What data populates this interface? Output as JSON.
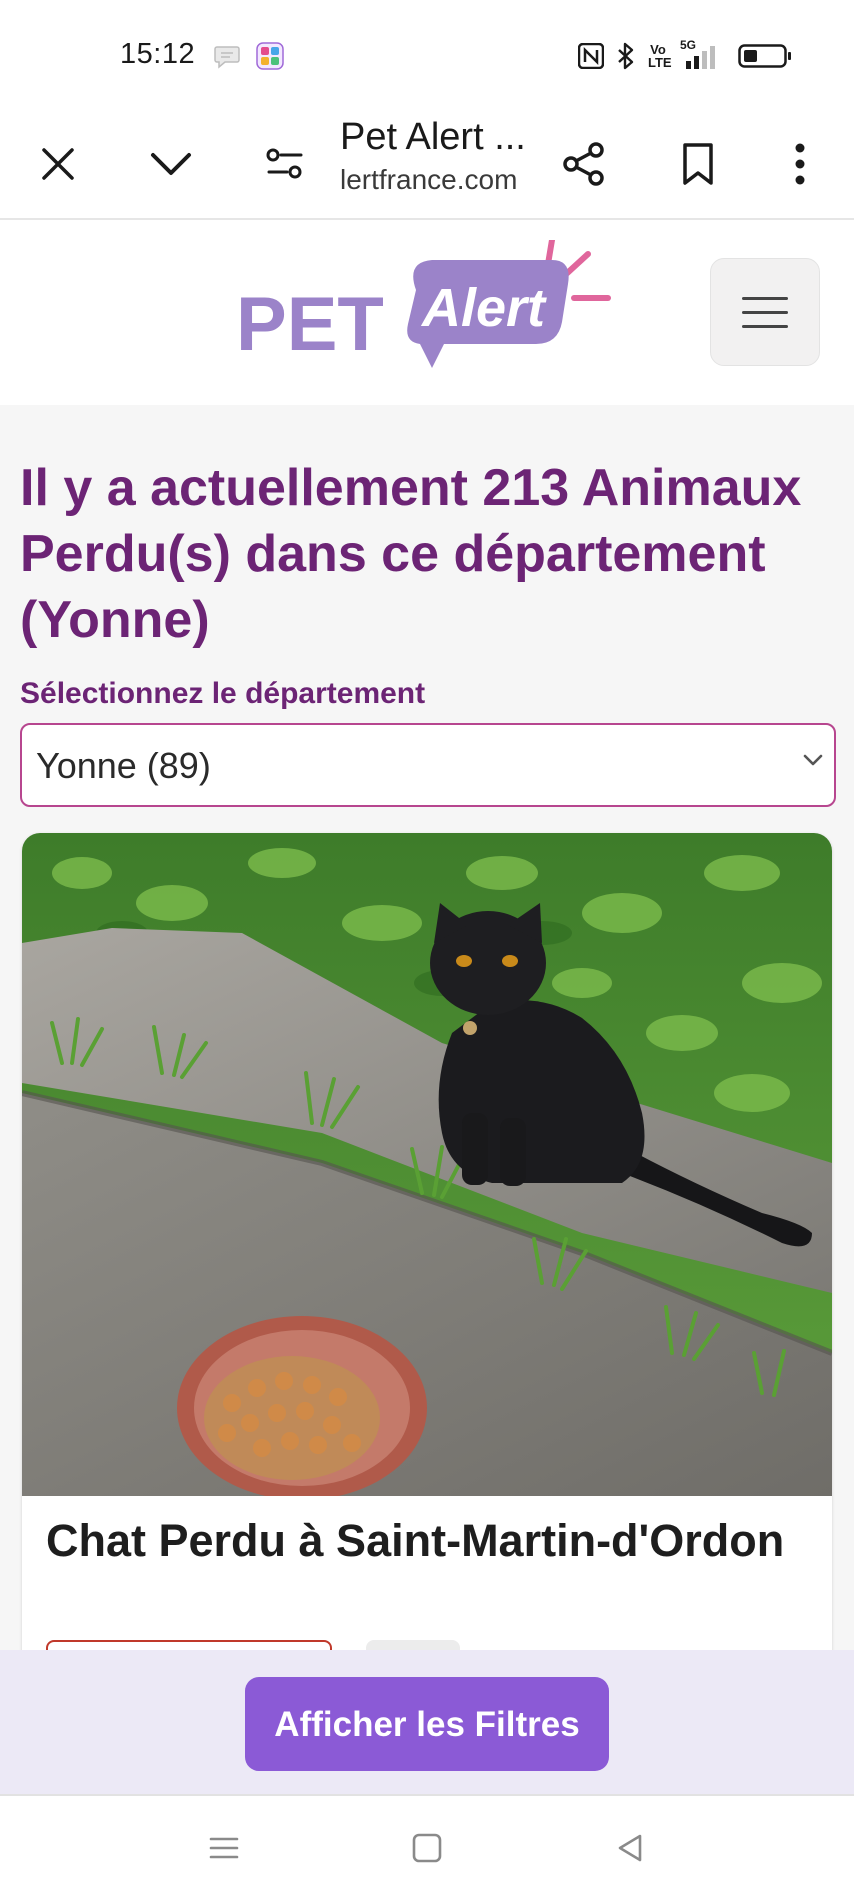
{
  "status_bar": {
    "time": "15:12",
    "icons": [
      "message-bubble-icon",
      "colorful-app-icon",
      "nfc-icon",
      "bluetooth-icon",
      "volte-icon",
      "5g-signal-icon",
      "battery-icon"
    ],
    "network": "5G",
    "volte": "Vo LTE"
  },
  "browser": {
    "page_title": "Pet Alert ...",
    "domain": "lertfrance.com",
    "icons": [
      "close-icon",
      "chevron-down-icon",
      "site-settings-icon",
      "share-icon",
      "bookmark-icon",
      "more-vert-icon"
    ]
  },
  "header": {
    "logo_word_1": "PET",
    "logo_word_2": "Alert",
    "menu_icon": "hamburger-menu-icon"
  },
  "main": {
    "heading": "Il y a actuellement 213 Animaux Perdu(s) dans ce département (Yonne)",
    "select_label": "Sélectionnez le département",
    "select_value": "Yonne (89)"
  },
  "card": {
    "title": "Chat Perdu à Saint-Martin-d'Ordon",
    "photo_subject": "black cat sitting on pavement next to food bowl"
  },
  "filter_bar": {
    "button_label": "Afficher les Filtres"
  },
  "nav_bar": {
    "icons": [
      "recent-apps-icon",
      "home-icon",
      "back-icon"
    ]
  },
  "colors": {
    "heading_purple": "#6c2475",
    "logo_lavender": "#9b83c9",
    "logo_pink": "#e0669c",
    "select_border": "#b7468f",
    "filter_button": "#8b5ad6",
    "filter_bar_bg": "#ece9f6",
    "content_bg": "#f6f6f6"
  }
}
